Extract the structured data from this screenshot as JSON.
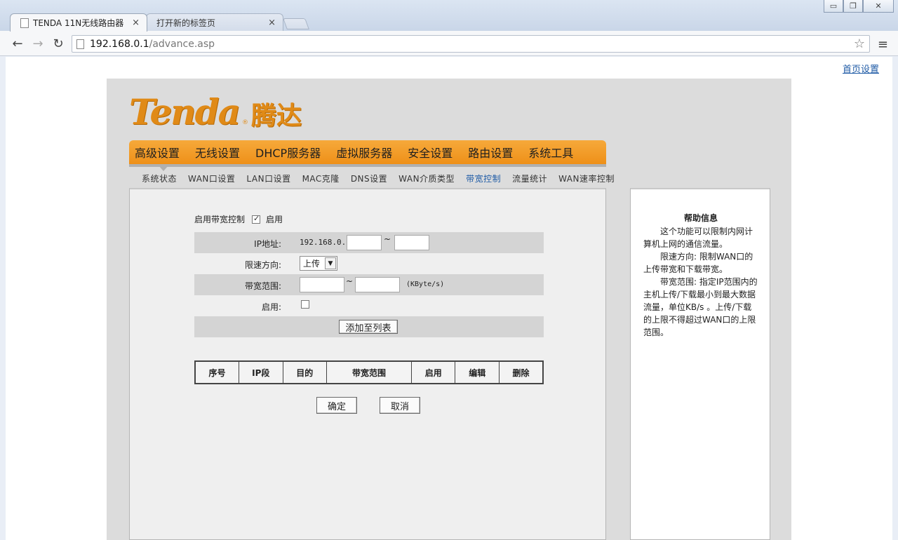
{
  "browser": {
    "tabs": [
      {
        "title": "TENDA 11N无线路由器",
        "close": "×"
      },
      {
        "title": "打开新的标签页",
        "close": "×"
      }
    ],
    "url": {
      "host": "192.168.0.1",
      "path": "/advance.asp"
    },
    "icons": {
      "back": "←",
      "forward": "→",
      "reload": "↻",
      "star": "☆",
      "menu": "≡",
      "minimize": "▭",
      "restore": "❐",
      "close": "✕"
    }
  },
  "page": {
    "home_link": "首页设置",
    "logo": {
      "en": "Tenda",
      "reg": "®",
      "cn": "腾达"
    },
    "main_nav": [
      "高级设置",
      "无线设置",
      "DHCP服务器",
      "虚拟服务器",
      "安全设置",
      "路由设置",
      "系统工具"
    ],
    "sub_nav": [
      "系统状态",
      "WAN口设置",
      "LAN口设置",
      "MAC克隆",
      "DNS设置",
      "WAN介质类型",
      "带宽控制",
      "流量统计",
      "WAN速率控制"
    ],
    "sub_nav_active": "带宽控制",
    "form": {
      "enable_bw_label": "启用带宽控制",
      "enable_bw_checked": true,
      "enable_bw_text": "启用",
      "ip_label": "IP地址:",
      "ip_prefix": "192.168.0.",
      "ip_sep": "~",
      "ip_start": "",
      "ip_end": "",
      "direction_label": "限速方向:",
      "direction_value": "上传",
      "direction_arrow": "▼",
      "range_label": "带宽范围:",
      "range_sep": "~",
      "range_min": "",
      "range_max": "",
      "range_unit": "(KByte/s)",
      "enable_label": "启用:",
      "enable_checked": false,
      "add_button": "添加至列表"
    },
    "table": {
      "headers": [
        "序号",
        "IP段",
        "目的",
        "带宽范围",
        "启用",
        "编辑",
        "删除"
      ],
      "rows": []
    },
    "ok_button": "确定",
    "cancel_button": "取消",
    "help": {
      "title": "帮助信息",
      "paragraphs": [
        "这个功能可以限制内网计算机上网的通信流量。",
        "限速方向: 限制WAN口的上传带宽和下载带宽。",
        "带宽范围: 指定IP范围内的主机上传/下载最小到最大数据流量，单位KB/s 。上传/下载的上限不得超过WAN口的上限范围。"
      ]
    }
  }
}
